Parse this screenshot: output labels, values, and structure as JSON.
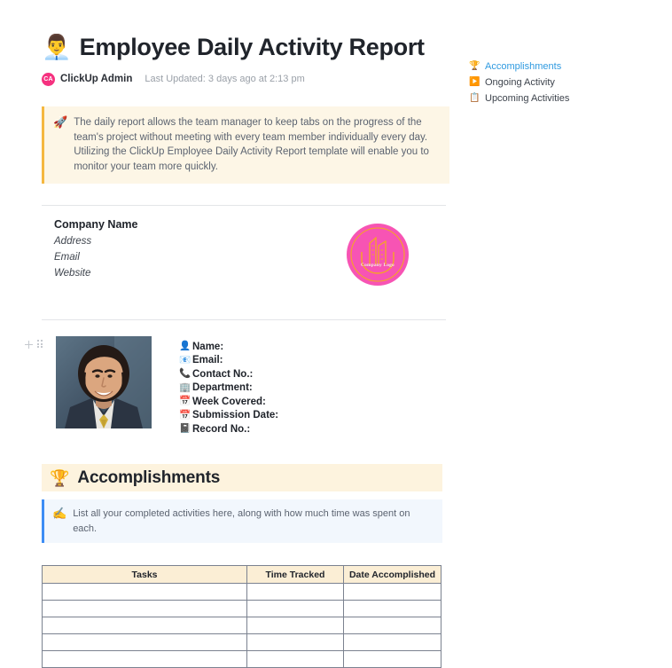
{
  "header": {
    "title": "Employee Daily Activity Report",
    "title_icon": "man-office-worker-icon",
    "title_emoji": "👨‍💼",
    "author_initials": "CA",
    "author": "ClickUp Admin",
    "last_updated": "Last Updated: 3 days ago at 2:13 pm"
  },
  "intro_callout": {
    "emoji": "🚀",
    "icon": "rocket-icon",
    "text": "The daily report allows the team manager to keep tabs on the progress of the team's project without meeting with every team member individually every day. Utilizing the ClickUp Employee Daily Activity Report template will enable you to monitor your team more quickly."
  },
  "company": {
    "name": "Company Name",
    "address": "Address",
    "email": "Email",
    "website": "Website",
    "logo_caption": "Company Logo",
    "logo_bg": "#f754b4",
    "logo_stroke": "#f5a623"
  },
  "employee_fields": [
    {
      "emoji": "👤",
      "icon": "person-icon",
      "label": "Name:"
    },
    {
      "emoji": "📧",
      "icon": "email-icon",
      "label": "Email:"
    },
    {
      "emoji": "📞",
      "icon": "phone-icon",
      "label": "Contact No.:"
    },
    {
      "emoji": "🏢",
      "icon": "building-icon",
      "label": "Department:"
    },
    {
      "emoji": "📅",
      "icon": "calendar-icon",
      "label": "Week Covered:"
    },
    {
      "emoji": "📅",
      "icon": "calendar-icon",
      "label": "Submission Date:"
    },
    {
      "emoji": "📓",
      "icon": "notebook-icon",
      "label": "Record No.:"
    }
  ],
  "section": {
    "emoji": "🏆",
    "icon": "trophy-icon",
    "title": "Accomplishments",
    "hint_emoji": "✍️",
    "hint_icon": "writing-hand-icon",
    "hint": "List all your completed activities here, along with how much time was spent on each."
  },
  "table": {
    "columns": [
      "Tasks",
      "Time Tracked",
      "Date Accomplished"
    ],
    "rows": [
      [
        "",
        "",
        ""
      ],
      [
        "",
        "",
        ""
      ],
      [
        "",
        "",
        ""
      ],
      [
        "",
        "",
        ""
      ],
      [
        "",
        "",
        ""
      ]
    ]
  },
  "outline": {
    "items": [
      {
        "emoji": "🏆",
        "icon": "trophy-icon",
        "label": "Accomplishments",
        "active": true
      },
      {
        "emoji": "▶️",
        "icon": "play-button-icon",
        "label": "Ongoing Activity",
        "active": false
      },
      {
        "emoji": "📋",
        "icon": "clipboard-icon",
        "label": "Upcoming Activities",
        "active": false
      }
    ]
  }
}
